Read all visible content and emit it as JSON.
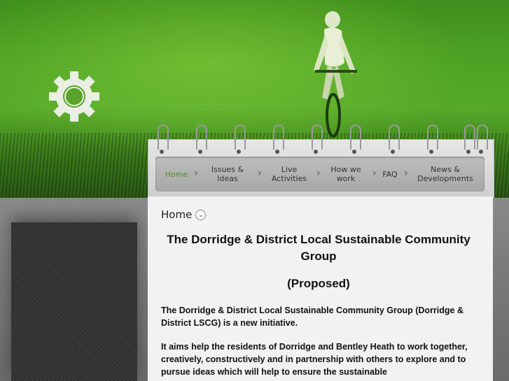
{
  "nav": {
    "items": [
      {
        "label": "Home",
        "active": true
      },
      {
        "label": "Issues & Ideas"
      },
      {
        "label": "Live Activities"
      },
      {
        "label": "How we work"
      },
      {
        "label": "FAQ"
      },
      {
        "label": "News & Developments"
      }
    ],
    "accent_color": "#4f8f26"
  },
  "breadcrumb": {
    "label": "Home",
    "icon": "chevron-down-icon"
  },
  "page": {
    "title": "The Dorridge & District Local Sustainable Community Group",
    "subtitle": "(Proposed)",
    "paragraph1": "The Dorridge & District Local Sustainable Community Group (Dorridge & District LSCG) is a new initiative.",
    "paragraph2": "It aims help the residents of Dorridge and Bentley Heath to work together, creatively, constructively and in partnership with others to explore and to pursue ideas which will help to ensure the sustainable"
  },
  "icons": {
    "logo": "gear-icon",
    "hero": "cyclist-image"
  }
}
